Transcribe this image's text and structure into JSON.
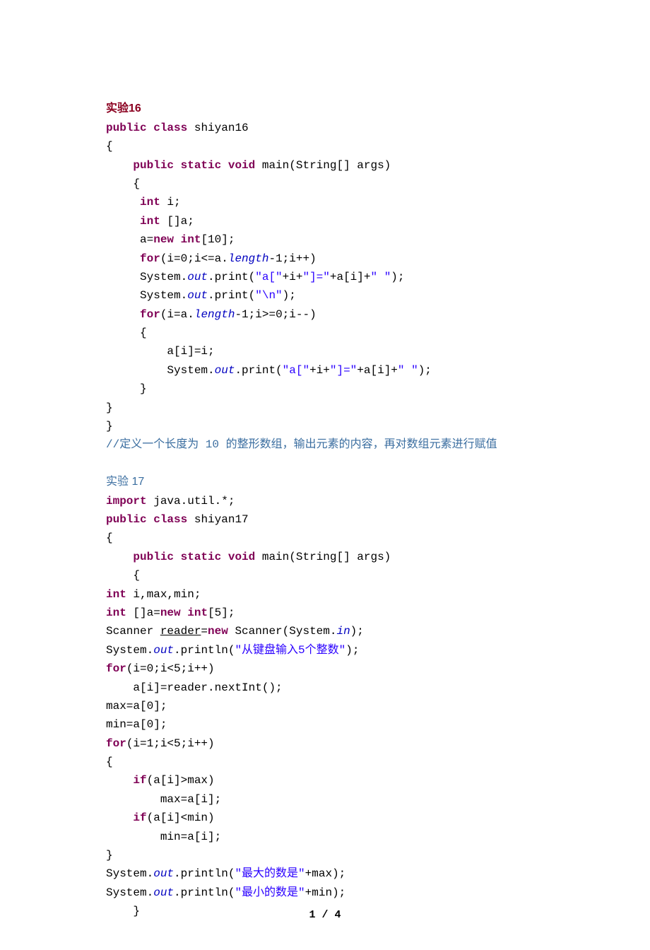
{
  "title16": "实验16",
  "l1a": "public",
  "l1b": "class",
  "l1c": " shiyan16",
  "l2": "{",
  "l3a": "    ",
  "l3b": "public",
  "l3c": "static",
  "l3d": "void",
  "l3e": " main(String[] args)",
  "l4": "    {",
  "l5a": "     ",
  "l5b": "int",
  "l5c": " i;",
  "l6a": "     ",
  "l6b": "int",
  "l6c": " []a;",
  "l7a": "     a=",
  "l7b": "new",
  "l7c": "int",
  "l7d": "[10];",
  "l8a": "     ",
  "l8b": "for",
  "l8c": "(i=0;i<=a.",
  "l8d": "length",
  "l8e": "-1;i++)",
  "l9a": "     System.",
  "l9b": "out",
  "l9c": ".print(",
  "l9d": "\"a[\"",
  "l9e": "+i+",
  "l9f": "\"]=\"",
  "l9g": "+a[i]+",
  "l9h": "\" \"",
  "l9i": ");",
  "l10a": "     System.",
  "l10b": "out",
  "l10c": ".print(",
  "l10d": "\"\\n\"",
  "l10e": ");",
  "l11a": "     ",
  "l11b": "for",
  "l11c": "(i=a.",
  "l11d": "length",
  "l11e": "-1;i>=0;i--)",
  "l12": "     {",
  "l13": "         a[i]=i;",
  "l14a": "         System.",
  "l14b": "out",
  "l14c": ".print(",
  "l14d": "\"a[\"",
  "l14e": "+i+",
  "l14f": "\"]=\"",
  "l14g": "+a[i]+",
  "l14h": "\" \"",
  "l14i": ");",
  "l15": "     }",
  "l16": "}",
  "l17": "}",
  "comment1a": "//",
  "comment1b": "定义一个长度为 10 的整形数组，输出元素的内容，再对数组元素进行赋值",
  "title17": "实验 17",
  "l20a": "import",
  "l20b": " java.util.*;",
  "l21a": "public",
  "l21b": "class",
  "l21c": " shiyan17",
  "l22": "{",
  "l23a": "    ",
  "l23b": "public",
  "l23c": "static",
  "l23d": "void",
  "l23e": " main(String[] args)",
  "l24": "    {",
  "l25a": "int",
  "l25b": " i,max,min;",
  "l26a": "int",
  "l26b": " []a=",
  "l26c": "new",
  "l26d": "int",
  "l26e": "[5];",
  "l27a": "Scanner ",
  "l27b": "reader",
  "l27c": "=",
  "l27d": "new",
  "l27e": " Scanner(System.",
  "l27f": "in",
  "l27g": ");",
  "l28a": "System.",
  "l28b": "out",
  "l28c": ".println(",
  "l28d": "\"从键盘输入5个整数\"",
  "l28e": ");",
  "l29a": "for",
  "l29b": "(i=0;i<5;i++)",
  "l30": "    a[i]=reader.nextInt();",
  "l31": "max=a[0];",
  "l32": "min=a[0];",
  "l33a": "for",
  "l33b": "(i=1;i<5;i++)",
  "l34": "{",
  "l35a": "    ",
  "l35b": "if",
  "l35c": "(a[i]>max)",
  "l36": "        max=a[i];",
  "l37a": "    ",
  "l37b": "if",
  "l37c": "(a[i]<min)",
  "l38": "        min=a[i];",
  "l39": "}",
  "l40a": "System.",
  "l40b": "out",
  "l40c": ".println(",
  "l40d": "\"最大的数是\"",
  "l40e": "+max);",
  "l41a": "System.",
  "l41b": "out",
  "l41c": ".println(",
  "l41d": "\"最小的数是\"",
  "l41e": "+min);",
  "l42": "    }",
  "pagenum": "1 / 4"
}
